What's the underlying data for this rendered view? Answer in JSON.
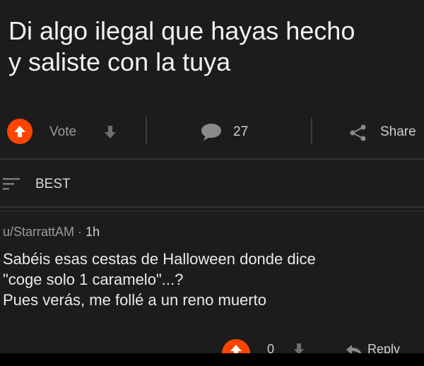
{
  "post": {
    "title_line1": "Di algo ilegal que hayas hecho",
    "title_line2": "y saliste con la tuya"
  },
  "actions": {
    "vote_label": "Vote",
    "comment_count": "27",
    "share_label": "Share"
  },
  "sort": {
    "label": "BEST"
  },
  "comment": {
    "author": "u/StarrattAM",
    "separator": "·",
    "age": "1h",
    "body": "Sabéis esas cestas de Halloween donde dice\n\"coge solo 1 caramelo\"...?\nPues verás, me follé a un reno muerto",
    "vote_count": "0",
    "reply_label": "Reply"
  },
  "colors": {
    "accent": "#ff4500",
    "background": "#1c1c1c",
    "muted": "#9a9a9a"
  }
}
